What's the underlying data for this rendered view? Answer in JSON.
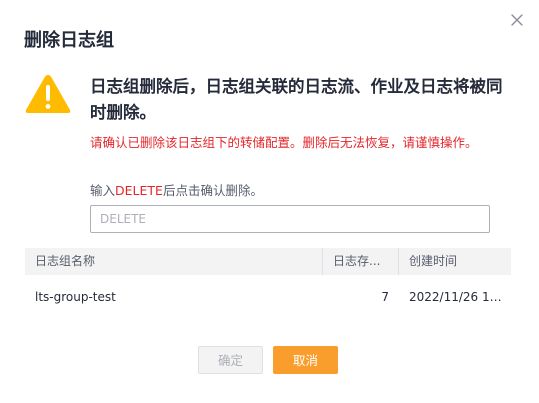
{
  "dialog": {
    "title": "删除日志组",
    "warning_main": "日志组删除后，日志组关联的日志流、作业及日志将被同时删除。",
    "warning_sub": "请确认已删除该日志组下的转储配置。删除后无法恢复，请谨慎操作。",
    "instruction_prefix": "输入",
    "instruction_keyword": "DELETE",
    "instruction_suffix": "后点击确认删除。",
    "input": {
      "value": "",
      "placeholder": "DELETE"
    },
    "table": {
      "columns": [
        "日志组名称",
        "日志存储时间",
        "创建时间"
      ],
      "columns_display": [
        "日志组名称",
        "日志存...",
        "创建时间"
      ],
      "rows": [
        {
          "name": "lts-group-test",
          "retention": "7",
          "created": "2022/11/26 16:..."
        }
      ]
    },
    "buttons": {
      "confirm": "确定",
      "cancel": "取消"
    }
  },
  "colors": {
    "danger": "#e4262b",
    "warning_icon": "#ffbb00",
    "primary_button": "#f99e2c",
    "header_bg": "#f3f3f3"
  },
  "icons": [
    "close-icon",
    "warning-icon"
  ]
}
